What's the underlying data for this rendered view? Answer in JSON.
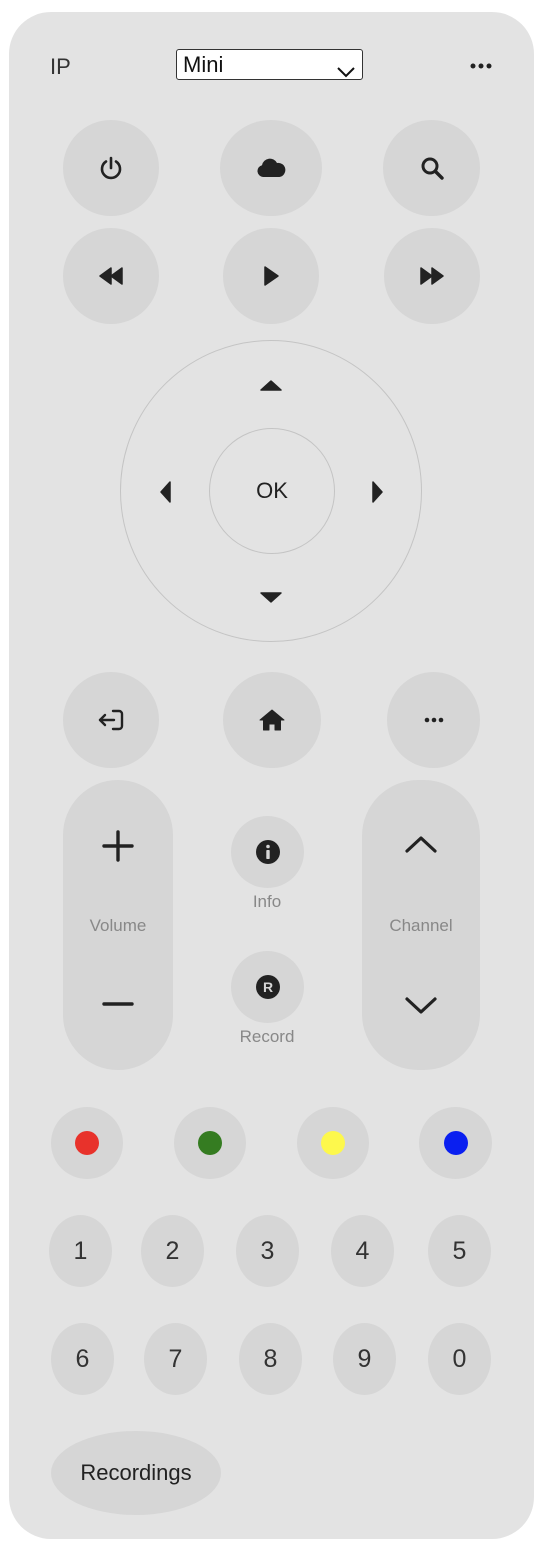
{
  "header": {
    "ip_label": "IP",
    "device_select": "Mini",
    "menu_icon": "more-horizontal-icon"
  },
  "row1": {
    "power": "power-icon",
    "cloud": "cloud-icon",
    "search": "search-icon"
  },
  "row2": {
    "rewind": "rewind-icon",
    "play": "play-icon",
    "fast_forward": "fast-forward-icon"
  },
  "dpad": {
    "ok_label": "OK"
  },
  "row3": {
    "back": "back-icon",
    "home": "home-icon",
    "more": "more-horizontal-icon"
  },
  "volume": {
    "label": "Volume"
  },
  "info": {
    "label": "Info"
  },
  "record": {
    "label": "Record",
    "icon_letter": "R"
  },
  "channel": {
    "label": "Channel"
  },
  "colors": [
    "#e8322b",
    "#357c21",
    "#fdf84c",
    "#0a1ff0"
  ],
  "numbers": [
    "1",
    "2",
    "3",
    "4",
    "5",
    "6",
    "7",
    "8",
    "9",
    "0"
  ],
  "recordings_label": "Recordings"
}
